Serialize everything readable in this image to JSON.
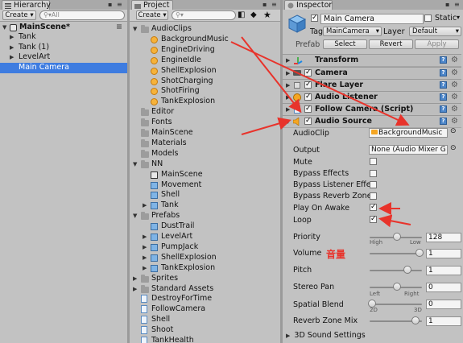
{
  "hierarchy": {
    "tab_title": "Hierarchy",
    "create_label": "Create",
    "search_placeholder": "All",
    "scene_name": "MainScene*",
    "items": [
      "Tank",
      "Tank (1)",
      "LevelArt",
      "Main Camera"
    ]
  },
  "project": {
    "tab_title": "Project",
    "create_label": "Create",
    "tree": [
      {
        "label": "AudioClips"
      },
      {
        "label": "BackgroundMusic"
      },
      {
        "label": "EngineDriving"
      },
      {
        "label": "EngineIdle"
      },
      {
        "label": "ShellExplosion"
      },
      {
        "label": "ShotCharging"
      },
      {
        "label": "ShotFiring"
      },
      {
        "label": "TankExplosion"
      },
      {
        "label": "Editor"
      },
      {
        "label": "Fonts"
      },
      {
        "label": "MainScene"
      },
      {
        "label": "Materials"
      },
      {
        "label": "Models"
      },
      {
        "label": "NN"
      },
      {
        "label": "MainScene"
      },
      {
        "label": "Movement"
      },
      {
        "label": "Shell"
      },
      {
        "label": "Tank"
      },
      {
        "label": "Prefabs"
      },
      {
        "label": "DustTrail"
      },
      {
        "label": "LevelArt"
      },
      {
        "label": "PumpJack"
      },
      {
        "label": "ShellExplosion"
      },
      {
        "label": "TankExplosion"
      },
      {
        "label": "Sprites"
      },
      {
        "label": "Standard Assets"
      },
      {
        "label": "DestroyForTime"
      },
      {
        "label": "FollowCamera"
      },
      {
        "label": "Shell"
      },
      {
        "label": "Shoot"
      },
      {
        "label": "TankHealth"
      }
    ]
  },
  "inspector": {
    "tab_title": "Inspector",
    "object_name": "Main Camera",
    "static_label": "Static",
    "tag_label": "Tag",
    "tag_value": "MainCamera",
    "layer_label": "Layer",
    "layer_value": "Default",
    "prefab_label": "Prefab",
    "select_label": "Select",
    "revert_label": "Revert",
    "apply_label": "Apply",
    "components": [
      "Transform",
      "Camera",
      "Flare Layer",
      "Audio Listener",
      "Follow Camera (Script)",
      "Audio Source"
    ],
    "audio_source": {
      "audioclip_label": "AudioClip",
      "audioclip_value": "BackgroundMusic",
      "output_label": "Output",
      "output_value": "None (Audio Mixer G",
      "mute_label": "Mute",
      "bypass_effects_label": "Bypass Effects",
      "bypass_listener_label": "Bypass Listener Effe",
      "bypass_reverb_label": "Bypass Reverb Zone",
      "play_on_awake_label": "Play On Awake",
      "loop_label": "Loop",
      "priority_label": "Priority",
      "priority_value": "128",
      "priority_high": "High",
      "priority_low": "Low",
      "volume_label": "Volume",
      "volume_value": "1",
      "volume_annotation": "音量",
      "pitch_label": "Pitch",
      "pitch_value": "1",
      "stereo_pan_label": "Stereo Pan",
      "stereo_pan_value": "0",
      "stereo_left": "Left",
      "stereo_right": "Right",
      "spatial_blend_label": "Spatial Blend",
      "spatial_blend_value": "0",
      "spatial_2d": "2D",
      "spatial_3d": "3D",
      "reverb_mix_label": "Reverb Zone Mix",
      "reverb_mix_value": "1",
      "sound3d_label": "3D Sound Settings"
    }
  },
  "colors": {
    "selection": "#3e7ce0",
    "annotation_red": "#e8332b"
  }
}
